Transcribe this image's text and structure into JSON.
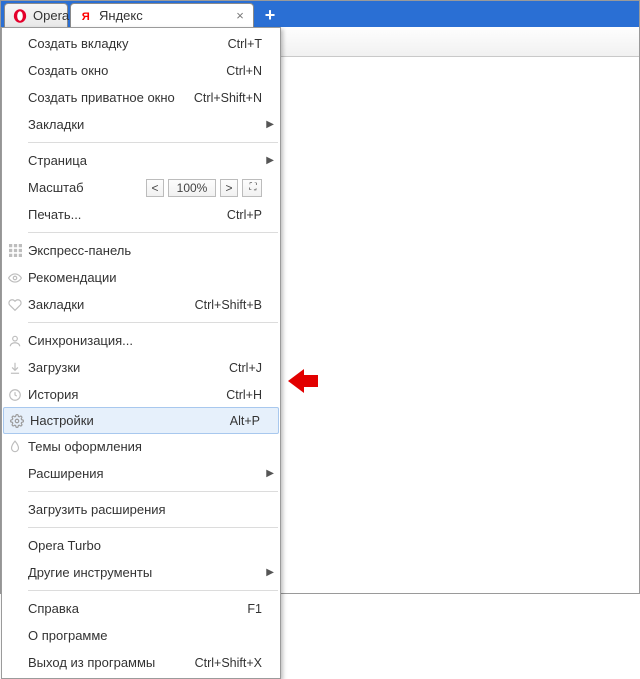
{
  "tabs": {
    "opera": {
      "label": "Opera"
    },
    "page": {
      "label": "Яндекс"
    }
  },
  "menu": {
    "new_tab": {
      "label": "Создать вкладку",
      "accel": "Ctrl+T"
    },
    "new_window": {
      "label": "Создать окно",
      "accel": "Ctrl+N"
    },
    "new_private": {
      "label": "Создать приватное окно",
      "accel": "Ctrl+Shift+N"
    },
    "bookmarks_sub": {
      "label": "Закладки"
    },
    "page_sub": {
      "label": "Страница"
    },
    "zoom_label": "Масштаб",
    "zoom_value": "100%",
    "print": {
      "label": "Печать...",
      "accel": "Ctrl+P"
    },
    "speed_dial": {
      "label": "Экспресс-панель"
    },
    "recommendations": {
      "label": "Рекомендации"
    },
    "bookmarks": {
      "label": "Закладки",
      "accel": "Ctrl+Shift+B"
    },
    "sync": {
      "label": "Синхронизация..."
    },
    "downloads": {
      "label": "Загрузки",
      "accel": "Ctrl+J"
    },
    "history": {
      "label": "История",
      "accel": "Ctrl+H"
    },
    "settings": {
      "label": "Настройки",
      "accel": "Alt+P"
    },
    "themes": {
      "label": "Темы оформления"
    },
    "extensions_sub": {
      "label": "Расширения"
    },
    "get_extensions": {
      "label": "Загрузить расширения"
    },
    "opera_turbo": {
      "label": "Opera Turbo"
    },
    "more_tools": {
      "label": "Другие инструменты"
    },
    "help": {
      "label": "Справка",
      "accel": "F1"
    },
    "about": {
      "label": "О программе"
    },
    "exit": {
      "label": "Выход из программы",
      "accel": "Ctrl+Shift+X"
    }
  }
}
